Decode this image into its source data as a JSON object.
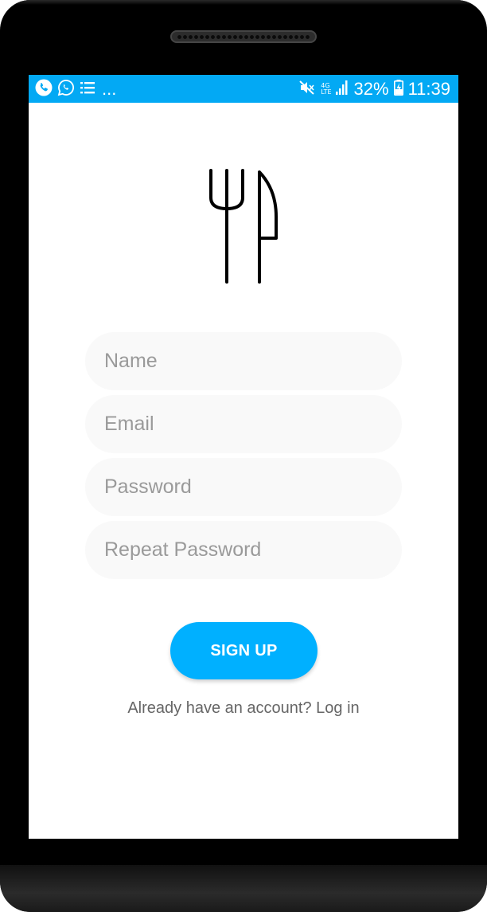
{
  "status_bar": {
    "left_icons": [
      "phone-call-icon",
      "whatsapp-icon",
      "list-icon"
    ],
    "overflow": "...",
    "network": "4G",
    "network_sub": "LTE",
    "battery": "32%",
    "time": "11:39",
    "background_color": "#03a9f4"
  },
  "logo": {
    "icon": "fork-knife-icon"
  },
  "form": {
    "name_placeholder": "Name",
    "email_placeholder": "Email",
    "password_placeholder": "Password",
    "repeat_password_placeholder": "Repeat Password",
    "field_color": "#f9f9f9"
  },
  "actions": {
    "signup_label": "SIGN UP",
    "signup_color": "#00b0ff",
    "login_prompt": "Already have an account? Log in"
  }
}
